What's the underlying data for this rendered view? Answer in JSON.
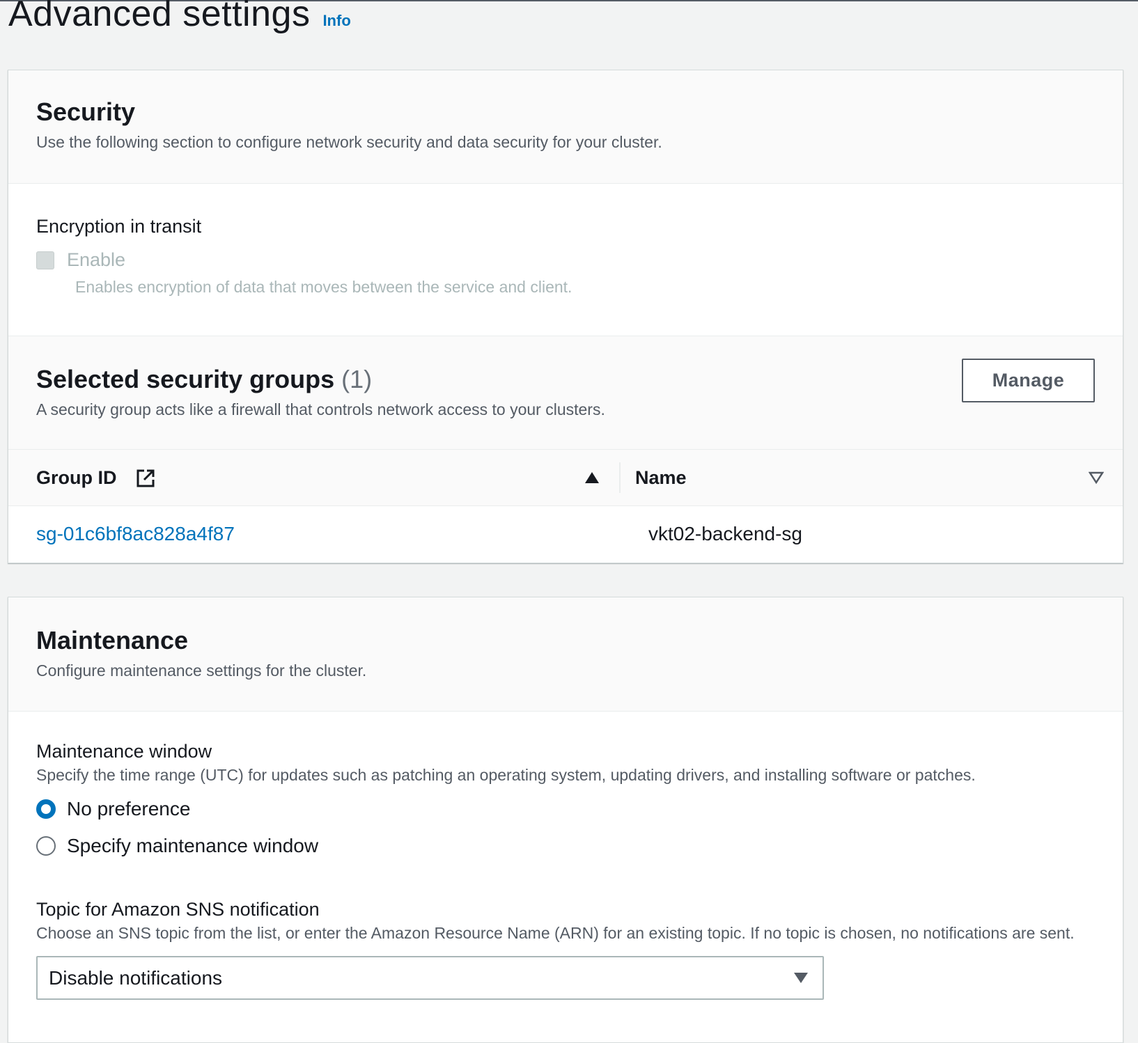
{
  "page": {
    "title": "Advanced settings",
    "info_link": "Info"
  },
  "security": {
    "title": "Security",
    "description": "Use the following section to configure network security and data security for your cluster.",
    "encryption": {
      "label": "Encryption in transit",
      "checkbox_label": "Enable",
      "checkbox_checked": false,
      "checkbox_disabled": true,
      "checkbox_description": "Enables encryption of data that moves between the service and client."
    },
    "security_groups": {
      "title": "Selected security groups",
      "count": "(1)",
      "description": "A security group acts like a firewall that controls network access to your clusters.",
      "manage_button": "Manage",
      "columns": [
        {
          "label": "Group ID",
          "icon": "external-link-icon",
          "sort": "ascending"
        },
        {
          "label": "Name",
          "sort": "unsorted"
        }
      ],
      "rows": [
        {
          "group_id": "sg-01c6bf8ac828a4f87",
          "name": "vkt02-backend-sg"
        }
      ]
    }
  },
  "maintenance": {
    "title": "Maintenance",
    "description": "Configure maintenance settings for the cluster.",
    "window": {
      "label": "Maintenance window",
      "description": "Specify the time range (UTC) for updates such as patching an operating system, updating drivers, and installing software or patches.",
      "options": [
        {
          "label": "No preference",
          "selected": true
        },
        {
          "label": "Specify maintenance window",
          "selected": false
        }
      ]
    },
    "sns": {
      "label": "Topic for Amazon SNS notification",
      "description": "Choose an SNS topic from the list, or enter the Amazon Resource Name (ARN) for an existing topic. If no topic is chosen, no notifications are sent.",
      "selected": "Disable notifications"
    }
  },
  "colors": {
    "link": "#0073bb",
    "text": "#16191f",
    "secondary_text": "#545b64",
    "disabled_text": "#aab7b8",
    "background": "#f2f3f3"
  }
}
